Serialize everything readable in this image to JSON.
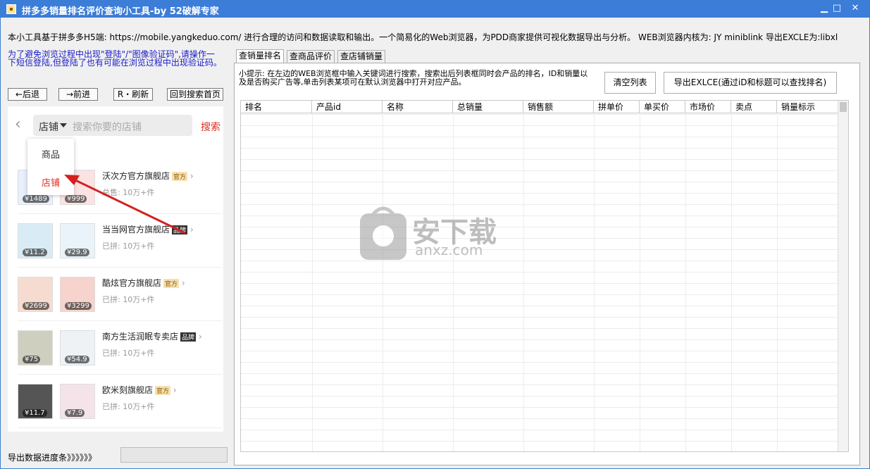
{
  "window": {
    "title": "拼多多销量排名评价查询小工具-by 52破解专家",
    "minimize": "▁",
    "maximize": "□",
    "close": "✕"
  },
  "info_text": "本小工具基于拼多多H5端: https://mobile.yangkeduo.com/ 进行合理的访问和数据读取和输出。一个简易化的Web浏览器，为PDD商家提供可视化数据导出与分析。 WEB浏览器内核为: JY miniblink 导出EXCLE为:libxl",
  "warning_text": "为了避免浏览过程中出现\"登陆\"/\"图像验证码\",请操作一下短信登陆,但登陆了也有可能在浏览过程中出现验证码。",
  "nav": {
    "back": "←后退",
    "forward": "→前进",
    "refresh": "R・刷新",
    "home": "回到搜索首页"
  },
  "webview": {
    "search_type": "店铺",
    "search_placeholder": "搜索你要的店铺",
    "search_button": "搜索",
    "dropdown": [
      "商品",
      "店铺"
    ],
    "stores": [
      {
        "name": "沃次方官方旗舰店",
        "tag": "官方",
        "sold": "总售: 10万+件",
        "prices": [
          "¥1489",
          "¥999"
        ]
      },
      {
        "name": "当当网官方旗舰店",
        "tag": "品牌",
        "sold": "已拼: 10万+件",
        "prices": [
          "¥11.2",
          "¥29.9"
        ]
      },
      {
        "name": "酷炫官方旗舰店",
        "tag": "官方",
        "sold": "已拼: 10万+件",
        "prices": [
          "¥2699",
          "¥3299"
        ]
      },
      {
        "name": "南方生活润眠专卖店",
        "tag": "品牌",
        "sold": "已拼: 10万+件",
        "prices": [
          "¥75",
          "¥54.9"
        ]
      },
      {
        "name": "欧米刻旗舰店",
        "tag": "官方",
        "sold": "已拼: 10万+件",
        "prices": [
          "¥11.7",
          "¥7.9"
        ]
      }
    ]
  },
  "progress": {
    "label": "导出数据进度条》》》》》》"
  },
  "tabs": [
    "查销量排名",
    "查商品评价",
    "查店铺销量"
  ],
  "panel": {
    "tip": "小提示: 在左边的WEB浏览框中输入关键词进行搜索，搜索出后列表框同时会产品的排名，ID和销量以及是否购买广告等,单击列表某项可在默认浏览器中打开对应产品。",
    "clear_button": "清空列表",
    "export_button": "导出EXLCE(通过iD和标题可以查找排名)",
    "columns": [
      "排名",
      "产品id",
      "名称",
      "总销量",
      "销售额",
      "拼单价",
      "单买价",
      "市场价",
      "卖点",
      "销量标示"
    ]
  },
  "watermark": {
    "cn": "安下载",
    "en": "anxz.com"
  },
  "colors": {
    "titlebar": "#3b7dd8",
    "accent_red": "#e02e24",
    "link_blue": "#1a1ac8"
  }
}
